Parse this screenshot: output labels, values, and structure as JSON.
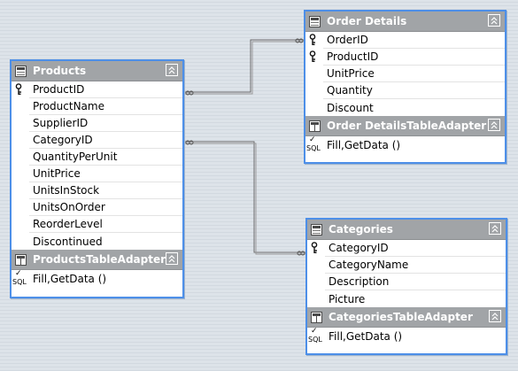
{
  "tables": {
    "products": {
      "name": "Products",
      "columns": [
        {
          "label": "ProductID",
          "key": true
        },
        {
          "label": "ProductName",
          "key": false
        },
        {
          "label": "SupplierID",
          "key": false
        },
        {
          "label": "CategoryID",
          "key": false
        },
        {
          "label": "QuantityPerUnit",
          "key": false
        },
        {
          "label": "UnitPrice",
          "key": false
        },
        {
          "label": "UnitsInStock",
          "key": false
        },
        {
          "label": "UnitsOnOrder",
          "key": false
        },
        {
          "label": "ReorderLevel",
          "key": false
        },
        {
          "label": "Discontinued",
          "key": false
        }
      ],
      "adapter": "ProductsTableAdapter",
      "query": "Fill,GetData ()"
    },
    "order_details": {
      "name": "Order Details",
      "columns": [
        {
          "label": "OrderID",
          "key": true
        },
        {
          "label": "ProductID",
          "key": true
        },
        {
          "label": "UnitPrice",
          "key": false
        },
        {
          "label": "Quantity",
          "key": false
        },
        {
          "label": "Discount",
          "key": false
        }
      ],
      "adapter": "Order DetailsTableAdapter",
      "query": "Fill,GetData ()"
    },
    "categories": {
      "name": "Categories",
      "columns": [
        {
          "label": "CategoryID",
          "key": true
        },
        {
          "label": "CategoryName",
          "key": false
        },
        {
          "label": "Description",
          "key": false
        },
        {
          "label": "Picture",
          "key": false
        }
      ],
      "adapter": "CategoriesTableAdapter",
      "query": "Fill,GetData ()"
    }
  },
  "icons": {
    "table": "table-icon",
    "adapter": "table-adapter-icon",
    "key": "primary-key-icon",
    "query": "sql-query-icon",
    "collapse": "collapse-chevron-icon"
  },
  "colors": {
    "border": "#4d8fe8",
    "header": "#a1a4a7",
    "background": "#dde3e9"
  }
}
